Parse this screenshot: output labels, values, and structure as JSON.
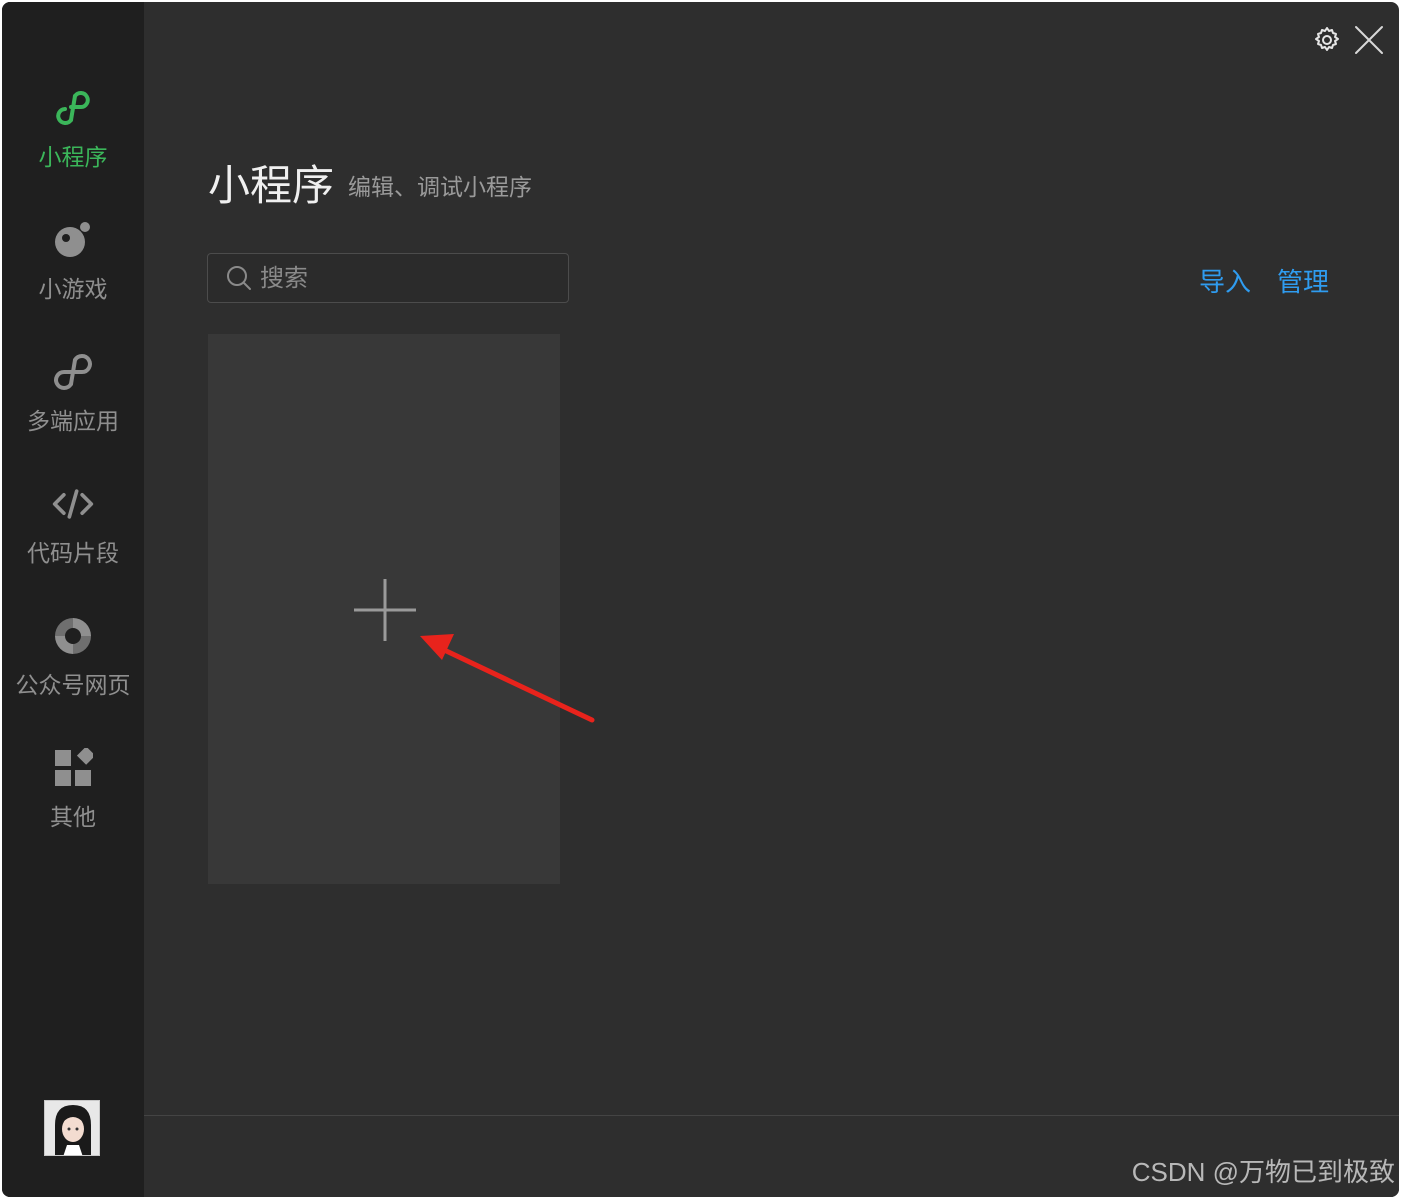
{
  "sidebar": {
    "items": [
      {
        "label": "小程序",
        "icon": "mini-program-icon",
        "active": true
      },
      {
        "label": "小游戏",
        "icon": "mini-game-icon",
        "active": false
      },
      {
        "label": "多端应用",
        "icon": "multi-platform-icon",
        "active": false
      },
      {
        "label": "代码片段",
        "icon": "code-snippet-icon",
        "active": false
      },
      {
        "label": "公众号网页",
        "icon": "official-account-icon",
        "active": false
      },
      {
        "label": "其他",
        "icon": "other-apps-icon",
        "active": false
      }
    ],
    "avatar": "avatar"
  },
  "header": {
    "title": "小程序",
    "subtitle": "编辑、调试小程序"
  },
  "search": {
    "placeholder": "搜索"
  },
  "actions": {
    "import_label": "导入",
    "manage_label": "管理"
  },
  "topbar": {
    "settings_icon": "gear-icon",
    "close_icon": "close-icon"
  },
  "new_project": {
    "icon": "plus-icon"
  },
  "watermark": "CSDN @万物已到极致",
  "colors": {
    "accent_green": "#3bb65a",
    "link_blue": "#2f9cf0",
    "annotation_red": "#e8231c"
  }
}
